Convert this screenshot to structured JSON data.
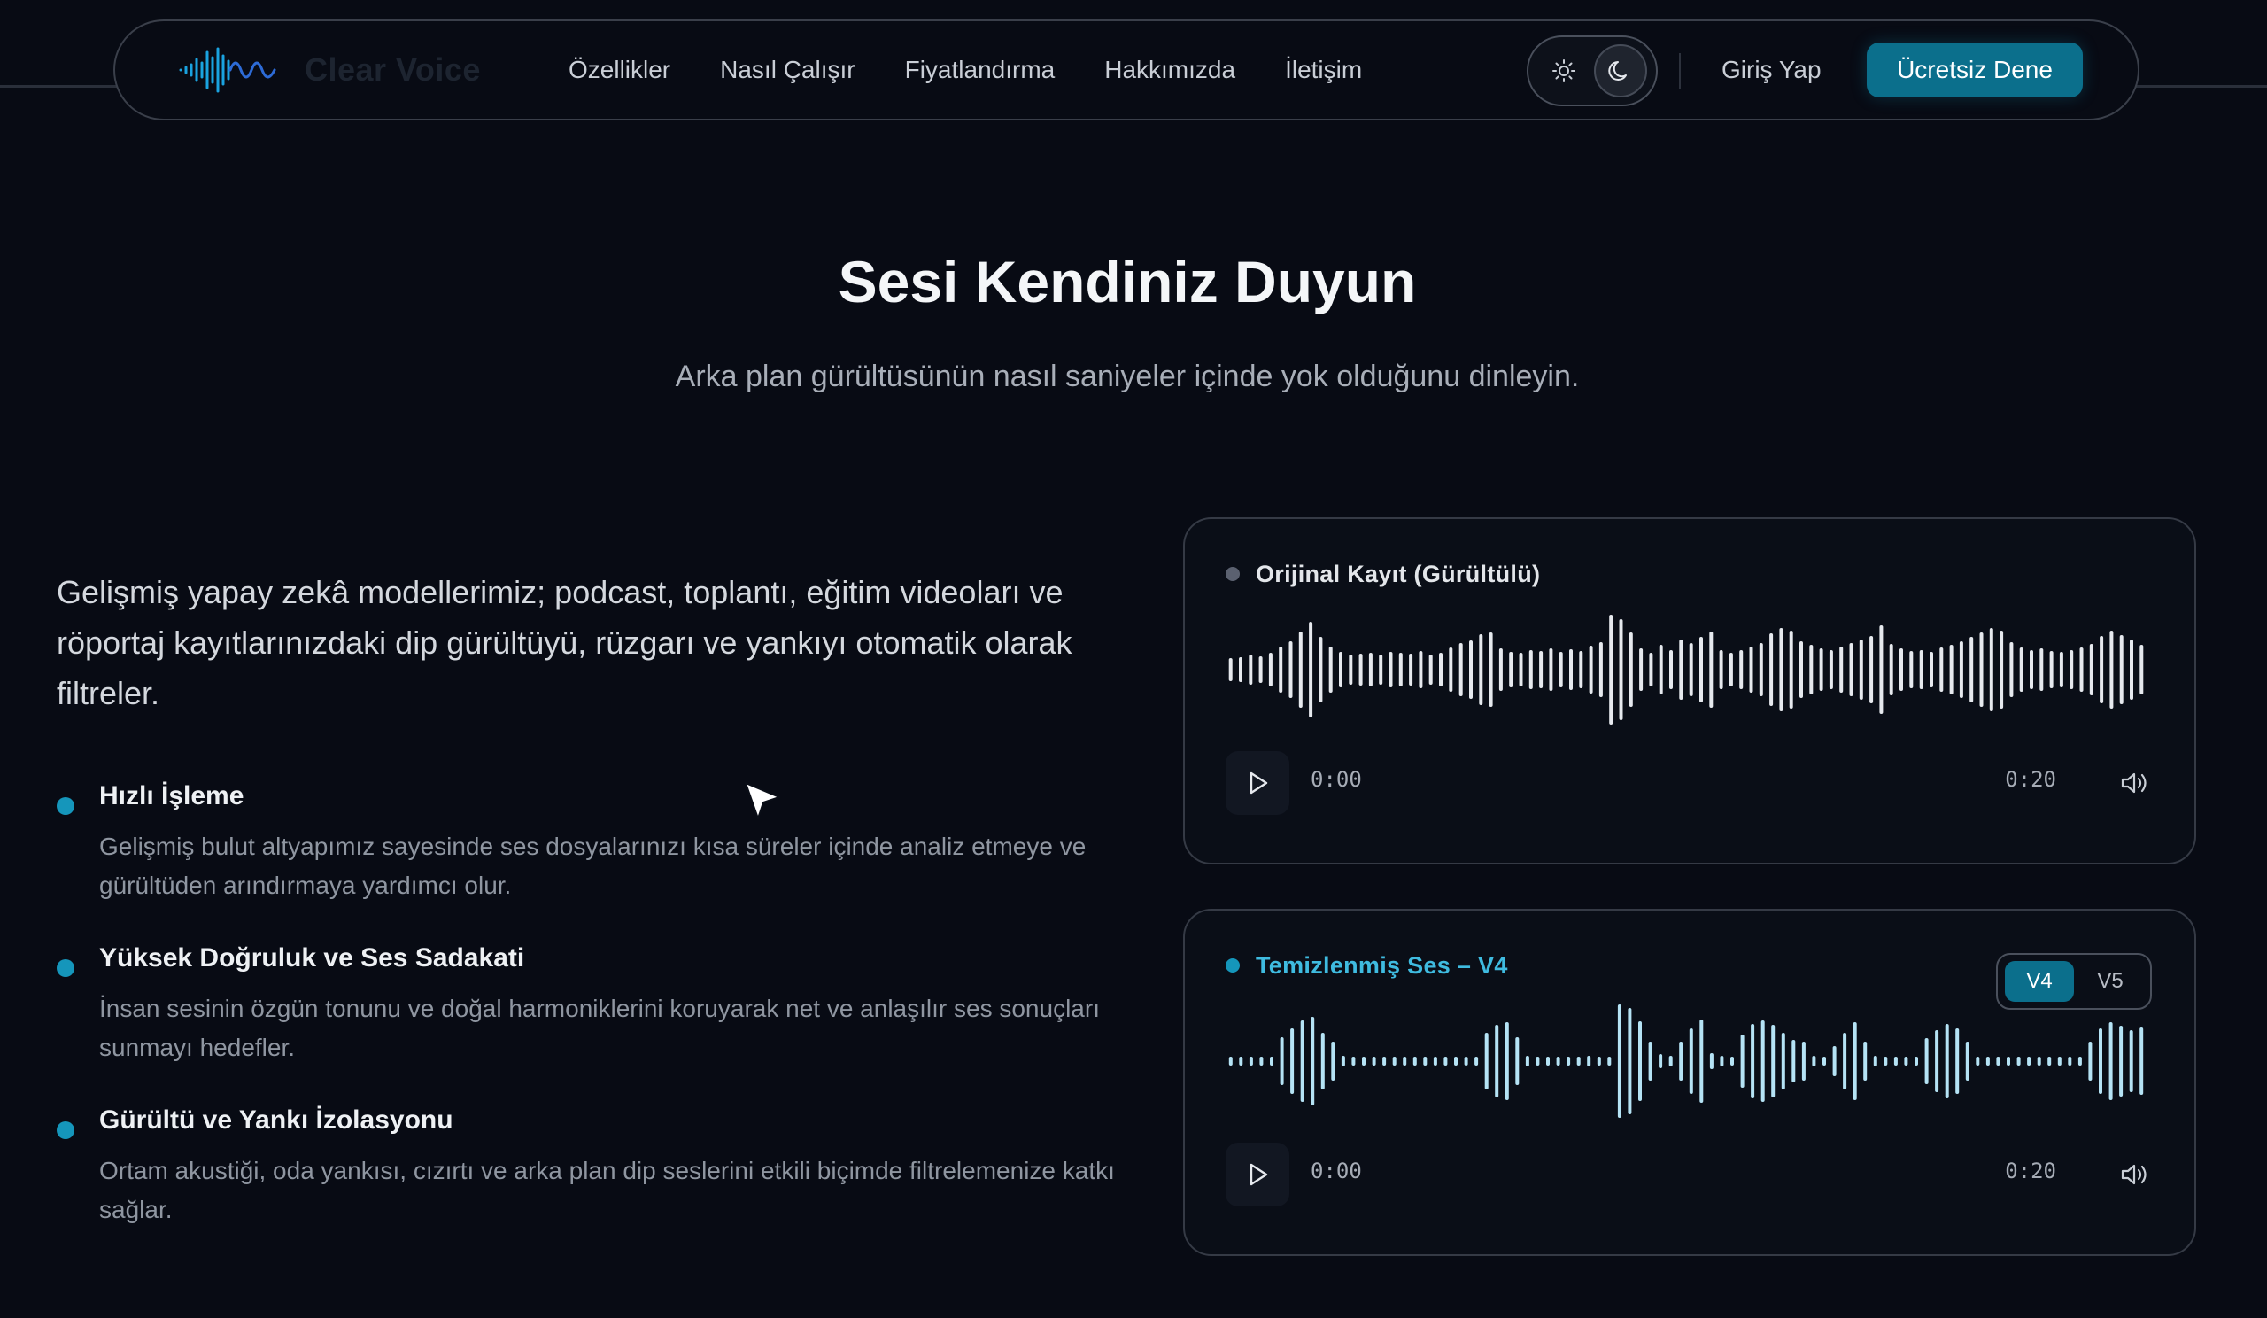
{
  "brand": {
    "name": "Clear Voice"
  },
  "nav": {
    "links": [
      "Özellikler",
      "Nasıl Çalışır",
      "Fiyatlandırma",
      "Hakkımızda",
      "İletişim"
    ],
    "login": "Giriş Yap",
    "cta": "Ücretsiz Dene",
    "theme_active": "dark"
  },
  "hero": {
    "title": "Sesi Kendiniz Duyun",
    "subtitle": "Arka plan gürültüsünün nasıl saniyeler içinde yok olduğunu dinleyin."
  },
  "intro": "Gelişmiş yapay zekâ modellerimiz; podcast, toplantı, eğitim videoları ve röportaj kayıtlarınızdaki dip gürültüyü, rüzgarı ve yankıyı otomatik olarak filtreler.",
  "features": [
    {
      "title": "Hızlı İşleme",
      "desc": "Gelişmiş bulut altyapımız sayesinde ses dosyalarınızı kısa süreler içinde analiz etmeye ve gürültüden arındırmaya yardımcı olur."
    },
    {
      "title": "Yüksek Doğruluk ve Ses Sadakati",
      "desc": "İnsan sesinin özgün tonunu ve doğal harmoniklerini koruyarak net ve anlaşılır ses sonuçları sunmayı hedefler."
    },
    {
      "title": "Gürültü ve Yankı İzolasyonu",
      "desc": "Ortam akustiği, oda yankısı, cızırtı ve arka plan dip seslerini etkili biçimde filtrelemenize katkı sağlar."
    }
  ],
  "players": {
    "original": {
      "label": "Orijinal Kayıt (Gürültülü)",
      "time_current": "0:00",
      "time_total": "0:20",
      "color": "#e6e9ee",
      "dot_color": "#5b6170",
      "label_color": "#e3e6ea"
    },
    "cleaned": {
      "label": "Temizlenmiş Ses – V4",
      "time_current": "0:00",
      "time_total": "0:20",
      "color": "#b5e3f5",
      "dot_color": "#1596bb",
      "label_color": "#3fbbe0",
      "versions": [
        "V4",
        "V5"
      ],
      "active_version": "V4"
    }
  },
  "colors": {
    "accent": "#0b6f8c",
    "background": "#080b14"
  }
}
